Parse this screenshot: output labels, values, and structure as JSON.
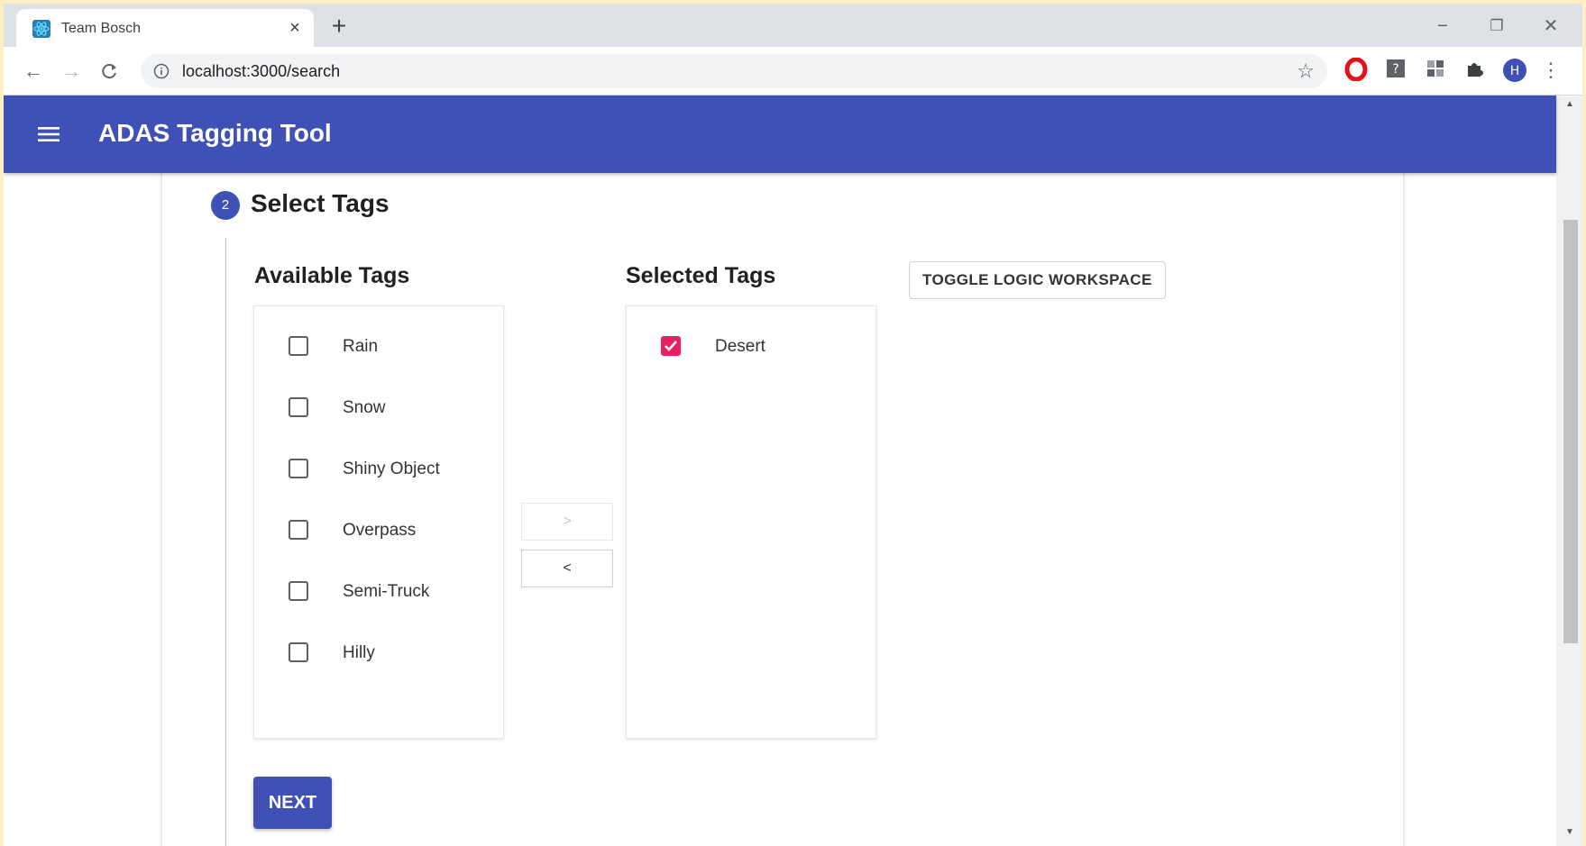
{
  "browser": {
    "tab_title": "Team Bosch",
    "tab_close": "×",
    "new_tab": "+",
    "url": "localhost:3000/search",
    "window_controls": {
      "minimize": "−",
      "restore": "❐",
      "close": "✕"
    }
  },
  "appbar": {
    "title": "ADAS Tagging Tool",
    "color": "#3f51b5"
  },
  "stepper": {
    "step_number": "2",
    "step_title": "Select Tags"
  },
  "available": {
    "heading": "Available Tags",
    "items": [
      "Rain",
      "Snow",
      "Shiny Object",
      "Overpass",
      "Semi-Truck",
      "Hilly"
    ]
  },
  "selected": {
    "heading": "Selected Tags",
    "items": [
      "Desert"
    ],
    "checked_color": "#e91e63"
  },
  "transfer": {
    "move_right": ">",
    "move_left": "<"
  },
  "actions": {
    "toggle_logic": "TOGGLE LOGIC WORKSPACE",
    "next": "NEXT"
  }
}
